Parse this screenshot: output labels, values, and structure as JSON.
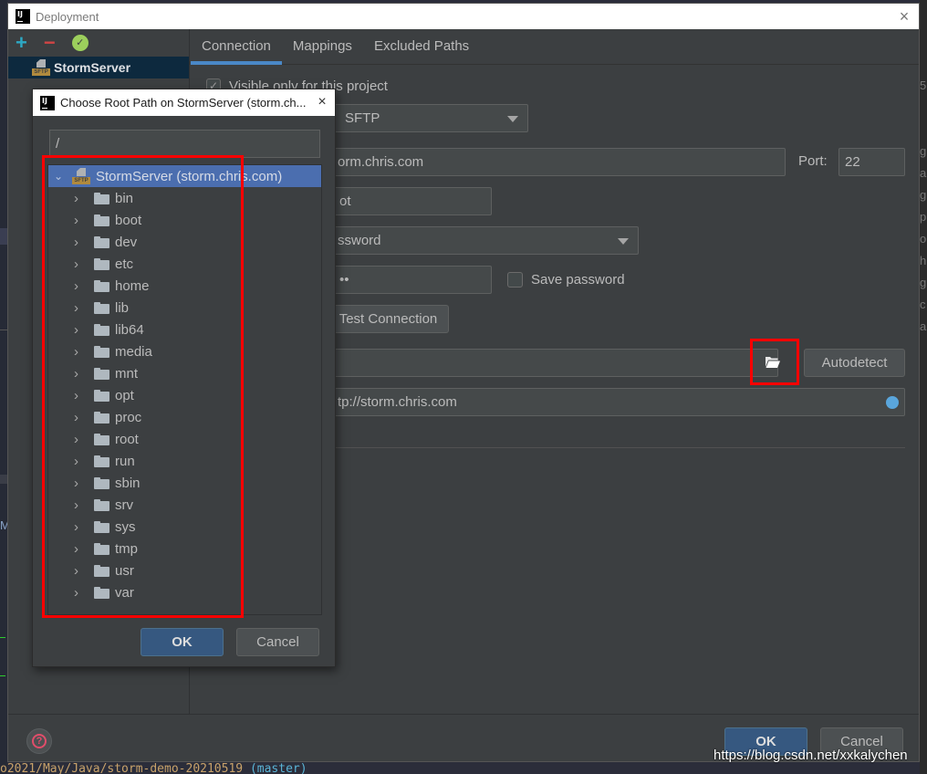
{
  "background": {
    "left_fragment": "M",
    "right_fragments": [
      "5",
      "g",
      "a",
      "g",
      "p",
      "o",
      "h",
      "g",
      "c",
      "a"
    ],
    "terminal": {
      "path": "o2021/May/Java/storm-demo-20210519",
      "branch": "(master)"
    }
  },
  "deployment": {
    "title": "Deployment",
    "close_icon": "×",
    "toolbar": {
      "add": "+",
      "remove": "−",
      "check": "✓"
    },
    "servers": [
      {
        "name": "StormServer",
        "type_badge": "SFTP",
        "selected": true
      }
    ],
    "tabs": [
      {
        "label": "Connection",
        "active": true
      },
      {
        "label": "Mappings",
        "active": false
      },
      {
        "label": "Excluded Paths",
        "active": false
      }
    ],
    "connection": {
      "visible_only_label": "Visible only for this project",
      "visible_only_checked": true,
      "type_value": "SFTP",
      "host_value": "orm.chris.com",
      "port_label": "Port:",
      "port_value": "22",
      "username_value": "ot",
      "auth_value": "ssword",
      "password_value": "••",
      "save_password_label": "Save password",
      "save_password_checked": false,
      "test_connection_label": "Test Connection",
      "root_path_value": "",
      "autodetect_label": "Autodetect",
      "web_url_value": "tp://storm.chris.com"
    },
    "footer": {
      "help": "?",
      "ok_label": "OK",
      "cancel_label": "Cancel"
    }
  },
  "chooser": {
    "title": "Choose Root Path on StormServer (storm.ch...",
    "close_icon": "×",
    "path_value": "/",
    "root_label": "StormServer (storm.chris.com)",
    "root_badge": "SFTP",
    "folders": [
      "bin",
      "boot",
      "dev",
      "etc",
      "home",
      "lib",
      "lib64",
      "media",
      "mnt",
      "opt",
      "proc",
      "root",
      "run",
      "sbin",
      "srv",
      "sys",
      "tmp",
      "usr",
      "var"
    ],
    "ok_label": "OK",
    "cancel_label": "Cancel"
  },
  "watermark": "https://blog.csdn.net/xxkalychen"
}
